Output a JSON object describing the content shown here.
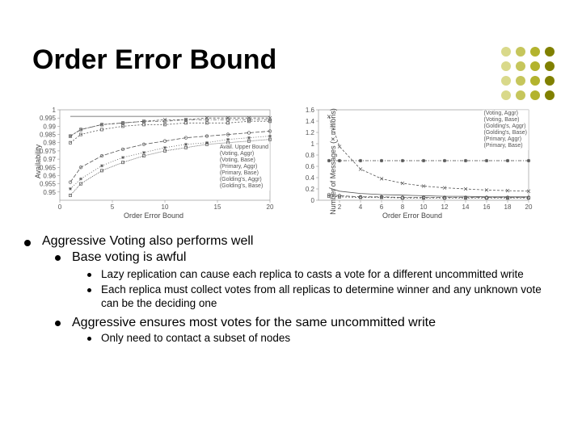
{
  "title": "Order Error Bound",
  "bullets": {
    "l1": "Aggressive Voting also performs well",
    "l2": "Base voting is awful",
    "l2a": "Lazy replication can cause each replica to casts a vote for a different uncommitted write",
    "l2b": "Each replica must collect votes from all replicas to determine winner and any unknown vote can be the deciding one",
    "l3": "Aggressive ensures most votes for the same uncommitted write",
    "l3a": "Only need to contact a subset of nodes"
  },
  "chart_data": [
    {
      "type": "line",
      "title": "",
      "xlabel": "Order Error Bound",
      "ylabel": "Availability",
      "xlim": [
        0,
        20
      ],
      "ylim": [
        0.945,
        1.0
      ],
      "x_ticks": [
        0,
        5,
        10,
        15,
        20
      ],
      "y_ticks": [
        0.95,
        0.955,
        0.96,
        0.965,
        0.97,
        0.975,
        0.98,
        0.985,
        0.99,
        0.995,
        1
      ],
      "x": [
        1,
        2,
        4,
        6,
        8,
        10,
        12,
        14,
        16,
        18,
        20
      ],
      "series": [
        {
          "name": "Avail. Upper Bound",
          "values": [
            0.996,
            0.996,
            0.996,
            0.996,
            0.996,
            0.996,
            0.996,
            0.996,
            0.996,
            0.996,
            0.996
          ]
        },
        {
          "name": "(Voting, Aggr)",
          "values": [
            0.984,
            0.988,
            0.991,
            0.992,
            0.993,
            0.994,
            0.994,
            0.995,
            0.995,
            0.995,
            0.995
          ]
        },
        {
          "name": "(Voting, Base)",
          "values": [
            0.952,
            0.958,
            0.966,
            0.971,
            0.974,
            0.977,
            0.979,
            0.98,
            0.982,
            0.983,
            0.984
          ]
        },
        {
          "name": "(Primary, Aggr)",
          "values": [
            0.984,
            0.988,
            0.991,
            0.992,
            0.993,
            0.993,
            0.994,
            0.994,
            0.994,
            0.994,
            0.994
          ]
        },
        {
          "name": "(Primary, Base)",
          "values": [
            0.98,
            0.985,
            0.988,
            0.99,
            0.991,
            0.991,
            0.992,
            0.992,
            0.992,
            0.993,
            0.993
          ]
        },
        {
          "name": "(Golding's, Aggr)",
          "values": [
            0.956,
            0.965,
            0.972,
            0.976,
            0.979,
            0.981,
            0.983,
            0.984,
            0.985,
            0.986,
            0.987
          ]
        },
        {
          "name": "(Golding's, Base)",
          "values": [
            0.948,
            0.955,
            0.963,
            0.968,
            0.972,
            0.975,
            0.977,
            0.979,
            0.98,
            0.981,
            0.982
          ]
        }
      ],
      "legend_pos": "inside-right-middle"
    },
    {
      "type": "line",
      "title": "",
      "xlabel": "Order Error Bound",
      "ylabel": "Number of Messages (× millions)",
      "xlim": [
        0,
        20
      ],
      "ylim": [
        0,
        1.6
      ],
      "x_ticks": [
        2,
        4,
        6,
        8,
        10,
        12,
        14,
        16,
        18,
        20
      ],
      "y_ticks": [
        0,
        0.2,
        0.4,
        0.6,
        0.8,
        1,
        1.2,
        1.4,
        1.6
      ],
      "x": [
        1,
        2,
        4,
        6,
        8,
        10,
        12,
        14,
        16,
        18,
        20
      ],
      "series": [
        {
          "name": "(Voting, Aggr)",
          "values": [
            0.22,
            0.16,
            0.12,
            0.1,
            0.09,
            0.08,
            0.07,
            0.07,
            0.06,
            0.06,
            0.06
          ]
        },
        {
          "name": "(Voting, Base)",
          "values": [
            1.48,
            0.95,
            0.55,
            0.38,
            0.3,
            0.25,
            0.22,
            0.2,
            0.18,
            0.17,
            0.16
          ]
        },
        {
          "name": "(Golding's, Aggr)",
          "values": [
            0.7,
            0.7,
            0.7,
            0.7,
            0.7,
            0.7,
            0.7,
            0.7,
            0.7,
            0.7,
            0.7
          ]
        },
        {
          "name": "(Golding's, Base)",
          "values": [
            0.7,
            0.7,
            0.7,
            0.7,
            0.7,
            0.7,
            0.7,
            0.7,
            0.7,
            0.7,
            0.7
          ]
        },
        {
          "name": "(Primary, Aggr)",
          "values": [
            0.07,
            0.06,
            0.05,
            0.05,
            0.04,
            0.04,
            0.04,
            0.04,
            0.04,
            0.04,
            0.04
          ]
        },
        {
          "name": "(Primary, Base)",
          "values": [
            0.1,
            0.08,
            0.06,
            0.06,
            0.05,
            0.05,
            0.05,
            0.05,
            0.05,
            0.05,
            0.05
          ]
        }
      ],
      "legend_pos": "inside-right-top"
    }
  ]
}
